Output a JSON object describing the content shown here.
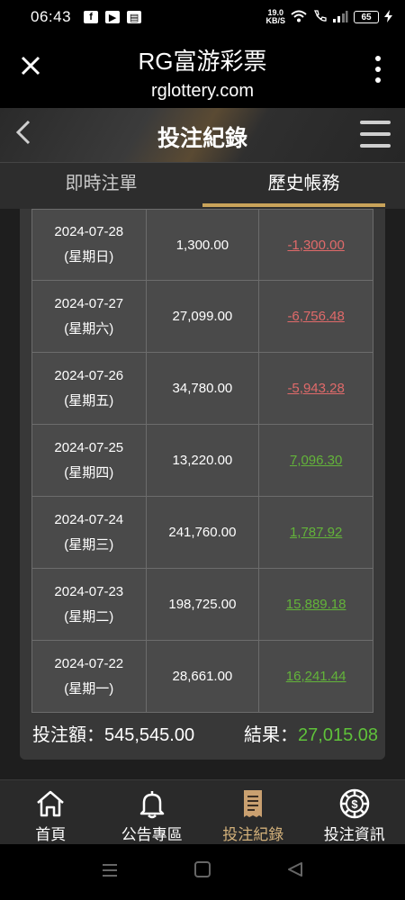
{
  "status_bar": {
    "time": "06:43",
    "speed_value": "19.0",
    "speed_unit": "KB/S",
    "battery": "65",
    "icons": [
      "facebook-icon",
      "youtube-icon",
      "news-icon",
      "wifi-icon",
      "call-icon",
      "signal-icon",
      "charging-icon"
    ]
  },
  "browser": {
    "title": "RG富游彩票",
    "url": "rglottery.com"
  },
  "header": {
    "title": "投注紀錄"
  },
  "tabs": [
    {
      "label": "即時注單",
      "active": false
    },
    {
      "label": "歷史帳務",
      "active": true
    }
  ],
  "records": [
    {
      "date": "2024-07-28",
      "weekday": "(星期日)",
      "amount": "1,300.00",
      "result": "-1,300.00",
      "sign": "neg"
    },
    {
      "date": "2024-07-27",
      "weekday": "(星期六)",
      "amount": "27,099.00",
      "result": "-6,756.48",
      "sign": "neg"
    },
    {
      "date": "2024-07-26",
      "weekday": "(星期五)",
      "amount": "34,780.00",
      "result": "-5,943.28",
      "sign": "neg"
    },
    {
      "date": "2024-07-25",
      "weekday": "(星期四)",
      "amount": "13,220.00",
      "result": "7,096.30",
      "sign": "pos"
    },
    {
      "date": "2024-07-24",
      "weekday": "(星期三)",
      "amount": "241,760.00",
      "result": "1,787.92",
      "sign": "pos"
    },
    {
      "date": "2024-07-23",
      "weekday": "(星期二)",
      "amount": "198,725.00",
      "result": "15,889.18",
      "sign": "pos"
    },
    {
      "date": "2024-07-22",
      "weekday": "(星期一)",
      "amount": "28,661.00",
      "result": "16,241.44",
      "sign": "pos"
    }
  ],
  "summary": {
    "bet_label": "投注額：",
    "bet_value": "545,545.00",
    "result_label": "結果：",
    "result_value": "27,015.08"
  },
  "bottom_nav": [
    {
      "label": "首頁",
      "icon": "home-icon",
      "active": false
    },
    {
      "label": "公告專區",
      "icon": "bell-icon",
      "active": false
    },
    {
      "label": "投注紀錄",
      "icon": "receipt-icon",
      "active": true
    },
    {
      "label": "投注資訊",
      "icon": "chip-icon",
      "active": false
    }
  ],
  "colors": {
    "accent": "#c9a35a",
    "negative": "#e06a6a",
    "positive": "#63b43a"
  }
}
